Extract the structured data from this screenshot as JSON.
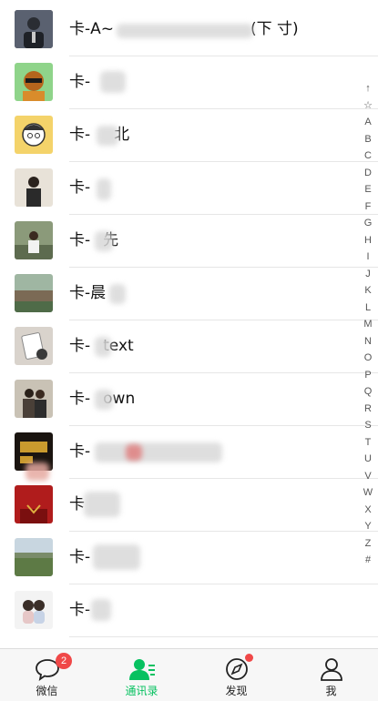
{
  "contacts": [
    {
      "name": "卡-A~",
      "tail": "(下 寸)"
    },
    {
      "name": "卡-"
    },
    {
      "name": "卡-",
      "tail": "北"
    },
    {
      "name": "卡-"
    },
    {
      "name": "卡-",
      "tail": "先"
    },
    {
      "name": "卡-",
      "tail": "晨"
    },
    {
      "name": "卡-",
      "tail": "text"
    },
    {
      "name": "卡-",
      "tail": "own"
    },
    {
      "name": "卡-"
    },
    {
      "name": "卡"
    },
    {
      "name": "卡-"
    },
    {
      "name": "卡-"
    }
  ],
  "index_bar": [
    "↑",
    "☆",
    "A",
    "B",
    "C",
    "D",
    "E",
    "F",
    "G",
    "H",
    "I",
    "J",
    "K",
    "L",
    "M",
    "N",
    "O",
    "P",
    "Q",
    "R",
    "S",
    "T",
    "U",
    "V",
    "W",
    "X",
    "Y",
    "Z",
    "#"
  ],
  "tabbar": {
    "tabs": [
      {
        "label": "微信",
        "icon": "chat-bubble-icon",
        "badge": "2"
      },
      {
        "label": "通讯录",
        "icon": "contacts-icon",
        "active": true
      },
      {
        "label": "发现",
        "icon": "compass-icon",
        "dot": true
      },
      {
        "label": "我",
        "icon": "person-icon"
      }
    ]
  },
  "colors": {
    "accent": "#07c160",
    "badge": "#f04848"
  }
}
